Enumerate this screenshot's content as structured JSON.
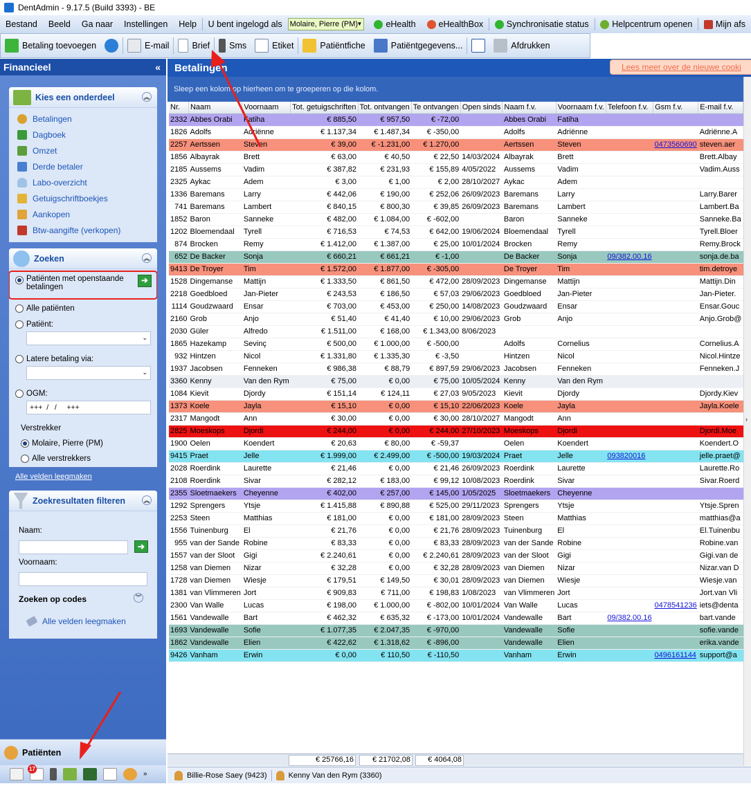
{
  "app": {
    "title": "DentAdmin - 9.17.5     (Build 3393) - BE"
  },
  "menu": {
    "items": [
      "Bestand",
      "Beeld",
      "Ga naar",
      "Instellingen",
      "Help"
    ],
    "logged_in_label": "U bent ingelogd als",
    "user_value": "Molaire, Pierre (PM)",
    "ehealth": "eHealth",
    "ehealthbox": "eHealthBox",
    "sync": "Synchronisatie status",
    "help": "Helpcentrum openen",
    "mine": "Mijn afs"
  },
  "toolbar": {
    "add_payment": "Betaling toevoegen",
    "email": "E-mail",
    "letter": "Brief",
    "sms": "Sms",
    "label": "Etiket",
    "patient_card": "Patiëntfiche",
    "patient_data": "Patiëntgegevens...",
    "print": "Afdrukken"
  },
  "sidebar": {
    "title": "Financieel",
    "collapse": "«",
    "choose": {
      "title": "Kies een onderdeel",
      "items": [
        "Betalingen",
        "Dagboek",
        "Omzet",
        "Derde betaler",
        "Labo-overzicht",
        "Getuigschriftboekjes",
        "Aankopen",
        "Btw-aangifte (verkopen)"
      ]
    },
    "search": {
      "title": "Zoeken",
      "opt_open": "Patiënten met openstaande betalingen",
      "opt_all": "Alle patiënten",
      "opt_patient": "Patiënt:",
      "opt_later": "Latere betaling via:",
      "opt_ogm": "OGM:",
      "ogm_value": "+++  /   /     +++",
      "provider_label": "Verstrekker",
      "provider_self": "Molaire, Pierre (PM)",
      "provider_all": "Alle verstrekkers",
      "clear_fields": "Alle velden leegmaken"
    },
    "filter": {
      "title": "Zoekresultaten filteren",
      "name_label": "Naam:",
      "firstname_label": "Voornaam:",
      "codes_label": "Zoeken op codes",
      "clear": "Alle velden leegmaken"
    },
    "patients_nav": "Patiënten",
    "badge_count": "17"
  },
  "main": {
    "title": "Betalingen",
    "learn_more": "Lees meer over de nieuwe cooki",
    "group_hint": "Sleep een kolom op hierheen om te groeperen op die kolom.",
    "columns": [
      "Nr.",
      "Naam",
      "Voornaam",
      "Tot. getuigschriften",
      "Tot. ontvangen",
      "Te ontvangen",
      "Open sinds",
      "Naam f.v.",
      "Voornaam f.v.",
      "Telefoon f.v.",
      "Gsm f.v.",
      "E-mail f.v."
    ],
    "rows": [
      [
        "2332",
        "Abbes Orabi",
        "Fatiha",
        "€ 885,50",
        "€ 957,50",
        "€ -72,00",
        "",
        "Abbes Orabi",
        "Fatiha",
        "",
        "",
        ""
      ],
      [
        "1826",
        "Adolfs",
        "Adriënne",
        "€ 1.137,34",
        "€ 1.487,34",
        "€ -350,00",
        "",
        "Adolfs",
        "Adriënne",
        "",
        "",
        "Adriënne.A"
      ],
      [
        "2257",
        "Aertssen",
        "Steven",
        "€ 39,00",
        "€ -1.231,00",
        "€ 1.270,00",
        "",
        "Aertssen",
        "Steven",
        "",
        "0473560690",
        "steven.aer"
      ],
      [
        "1856",
        "Albayrak",
        "Brett",
        "€ 63,00",
        "€ 40,50",
        "€ 22,50",
        "14/03/2024",
        "Albayrak",
        "Brett",
        "",
        "",
        "Brett.Albay"
      ],
      [
        "2185",
        "Aussems",
        "Vadim",
        "€ 387,82",
        "€ 231,93",
        "€ 155,89",
        "4/05/2022",
        "Aussems",
        "Vadim",
        "",
        "",
        "Vadim.Auss"
      ],
      [
        "2325",
        "Aykac",
        "Adem",
        "€ 3,00",
        "€ 1,00",
        "€ 2,00",
        "28/10/2027",
        "Aykac",
        "Adem",
        "",
        "",
        ""
      ],
      [
        "1336",
        "Baremans",
        "Larry",
        "€ 442,06",
        "€ 190,00",
        "€ 252,06",
        "26/09/2023",
        "Baremans",
        "Larry",
        "",
        "",
        "Larry.Barer"
      ],
      [
        "741",
        "Baremans",
        "Lambert",
        "€ 840,15",
        "€ 800,30",
        "€ 39,85",
        "26/09/2023",
        "Baremans",
        "Lambert",
        "",
        "",
        "Lambert.Ba"
      ],
      [
        "1852",
        "Baron",
        "Sanneke",
        "€ 482,00",
        "€ 1.084,00",
        "€ -602,00",
        "",
        "Baron",
        "Sanneke",
        "",
        "",
        "Sanneke.Ba"
      ],
      [
        "1202",
        "Bloemendaal",
        "Tyrell",
        "€ 716,53",
        "€ 74,53",
        "€ 642,00",
        "19/06/2024",
        "Bloemendaal",
        "Tyrell",
        "",
        "",
        "Tyrell.Bloer"
      ],
      [
        "874",
        "Brocken",
        "Remy",
        "€ 1.412,00",
        "€ 1.387,00",
        "€ 25,00",
        "10/01/2024",
        "Brocken",
        "Remy",
        "",
        "",
        "Remy.Brock"
      ],
      [
        "652",
        "De Backer",
        "Sonja",
        "€ 660,21",
        "€ 661,21",
        "€ -1,00",
        "",
        "De Backer",
        "Sonja",
        "09/382.00.16",
        "",
        "sonja.de.ba"
      ],
      [
        "9413",
        "De Troyer",
        "Tim",
        "€ 1.572,00",
        "€ 1.877,00",
        "€ -305,00",
        "",
        "De Troyer",
        "Tim",
        "",
        "",
        "tim.detroye"
      ],
      [
        "1528",
        "Dingemanse",
        "Mattijn",
        "€ 1.333,50",
        "€ 861,50",
        "€ 472,00",
        "28/09/2023",
        "Dingemanse",
        "Mattijn",
        "",
        "",
        "Mattijn.Din"
      ],
      [
        "2218",
        "Goedbloed",
        "Jan-Pieter",
        "€ 243,53",
        "€ 186,50",
        "€ 57,03",
        "29/06/2023",
        "Goedbloed",
        "Jan-Pieter",
        "",
        "",
        "Jan-Pieter."
      ],
      [
        "1114",
        "Goudzwaard",
        "Ensar",
        "€ 703,00",
        "€ 453,00",
        "€ 250,00",
        "14/08/2023",
        "Goudzwaard",
        "Ensar",
        "",
        "",
        "Ensar.Gouc"
      ],
      [
        "2160",
        "Grob",
        "Anjo",
        "€ 51,40",
        "€ 41,40",
        "€ 10,00",
        "29/06/2023",
        "Grob",
        "Anjo",
        "",
        "",
        "Anjo.Grob@"
      ],
      [
        "2030",
        "Güler",
        "Alfredo",
        "€ 1.511,00",
        "€ 168,00",
        "€ 1.343,00",
        "8/06/2023",
        "",
        "",
        "",
        "",
        ""
      ],
      [
        "1865",
        "Hazekamp",
        "Sevinç",
        "€ 500,00",
        "€ 1.000,00",
        "€ -500,00",
        "",
        "Adolfs",
        "Cornelius",
        "",
        "",
        "Cornelius.A"
      ],
      [
        "932",
        "Hintzen",
        "Nicol",
        "€ 1.331,80",
        "€ 1.335,30",
        "€ -3,50",
        "",
        "Hintzen",
        "Nicol",
        "",
        "",
        "Nicol.Hintze"
      ],
      [
        "1937",
        "Jacobsen",
        "Fenneken",
        "€ 986,38",
        "€ 88,79",
        "€ 897,59",
        "29/06/2023",
        "Jacobsen",
        "Fenneken",
        "",
        "",
        "Fenneken.J"
      ],
      [
        "3360",
        "Kenny",
        "Van den Rym",
        "€ 75,00",
        "€ 0,00",
        "€ 75,00",
        "10/05/2024",
        "Kenny",
        "Van den Rym",
        "",
        "",
        ""
      ],
      [
        "1084",
        "Kievit",
        "Djordy",
        "€ 151,14",
        "€ 124,11",
        "€ 27,03",
        "9/05/2023",
        "Kievit",
        "Djordy",
        "",
        "",
        "Djordy.Kiev"
      ],
      [
        "1373",
        "Koele",
        "Jayla",
        "€ 15,10",
        "€ 0,00",
        "€ 15,10",
        "22/06/2023",
        "Koele",
        "Jayla",
        "",
        "",
        "Jayla.Koele"
      ],
      [
        "2317",
        "Mangodt",
        "Ann",
        "€ 30,00",
        "€ 0,00",
        "€ 30,00",
        "28/10/2027",
        "Mangodt",
        "Ann",
        "",
        "",
        ""
      ],
      [
        "2825",
        "Moeskops",
        "Djordi",
        "€ 244,00",
        "€ 0,00",
        "€ 244,00",
        "27/10/2023",
        "Moeskops",
        "Djordi",
        "",
        "",
        "Djordi.Moe"
      ],
      [
        "1900",
        "Oelen",
        "Koendert",
        "€ 20,63",
        "€ 80,00",
        "€ -59,37",
        "",
        "Oelen",
        "Koendert",
        "",
        "",
        "Koendert.O"
      ],
      [
        "9415",
        "Praet",
        "Jelle",
        "€ 1.999,00",
        "€ 2.499,00",
        "€ -500,00",
        "19/03/2024",
        "Praet",
        "Jelle",
        "093820016",
        "",
        "jelle.praet@"
      ],
      [
        "2028",
        "Roerdink",
        "Laurette",
        "€ 21,46",
        "€ 0,00",
        "€ 21,46",
        "26/09/2023",
        "Roerdink",
        "Laurette",
        "",
        "",
        "Laurette.Ro"
      ],
      [
        "2108",
        "Roerdink",
        "Sivar",
        "€ 282,12",
        "€ 183,00",
        "€ 99,12",
        "10/08/2023",
        "Roerdink",
        "Sivar",
        "",
        "",
        "Sivar.Roerd"
      ],
      [
        "2355",
        "Sloetmaekers",
        "Cheyenne",
        "€ 402,00",
        "€ 257,00",
        "€ 145,00",
        "1/05/2025",
        "Sloetmaekers",
        "Cheyenne",
        "",
        "",
        ""
      ],
      [
        "1292",
        "Sprengers",
        "Ytsje",
        "€ 1.415,88",
        "€ 890,88",
        "€ 525,00",
        "29/11/2023",
        "Sprengers",
        "Ytsje",
        "",
        "",
        "Ytsje.Spren"
      ],
      [
        "2253",
        "Steen",
        "Matthias",
        "€ 181,00",
        "€ 0,00",
        "€ 181,00",
        "28/09/2023",
        "Steen",
        "Matthias",
        "",
        "",
        "matthias@a"
      ],
      [
        "1556",
        "Tuinenburg",
        "El",
        "€ 21,76",
        "€ 0,00",
        "€ 21,76",
        "28/09/2023",
        "Tuinenburg",
        "El",
        "",
        "",
        "El.Tuinenbu"
      ],
      [
        "955",
        "van der Sande",
        "Robine",
        "€ 83,33",
        "€ 0,00",
        "€ 83,33",
        "28/09/2023",
        "van der Sande",
        "Robine",
        "",
        "",
        "Robine.van"
      ],
      [
        "1557",
        "van der Sloot",
        "Gigi",
        "€ 2.240,61",
        "€ 0,00",
        "€ 2.240,61",
        "28/09/2023",
        "van der Sloot",
        "Gigi",
        "",
        "",
        "Gigi.van de"
      ],
      [
        "1258",
        "van Diemen",
        "Nizar",
        "€ 32,28",
        "€ 0,00",
        "€ 32,28",
        "28/09/2023",
        "van Diemen",
        "Nizar",
        "",
        "",
        "Nizar.van D"
      ],
      [
        "1728",
        "van Diemen",
        "Wiesje",
        "€ 179,51",
        "€ 149,50",
        "€ 30,01",
        "28/09/2023",
        "van Diemen",
        "Wiesje",
        "",
        "",
        "Wiesje.van"
      ],
      [
        "1381",
        "van Vlimmeren",
        "Jort",
        "€ 909,83",
        "€ 711,00",
        "€ 198,83",
        "1/08/2023",
        "van Vlimmeren",
        "Jort",
        "",
        "",
        "Jort.van Vli"
      ],
      [
        "2300",
        "Van Walle",
        "Lucas",
        "€ 198,00",
        "€ 1.000,00",
        "€ -802,00",
        "10/01/2024",
        "Van Walle",
        "Lucas",
        "",
        "0478541236",
        "iets@denta"
      ],
      [
        "1561",
        "Vandewalle",
        "Bart",
        "€ 462,32",
        "€ 635,32",
        "€ -173,00",
        "10/01/2024",
        "Vandewalle",
        "Bart",
        "09/382.00.16",
        "",
        "bart.vande"
      ],
      [
        "1693",
        "Vandewalle",
        "Sofie",
        "€ 1.077,35",
        "€ 2.047,35",
        "€ -970,00",
        "",
        "Vandewalle",
        "Sofie",
        "",
        "",
        "sofie.vande"
      ],
      [
        "1862",
        "Vandewalle",
        "Elien",
        "€ 422,62",
        "€ 1.318,62",
        "€ -896,00",
        "",
        "Vandewalle",
        "Elien",
        "",
        "",
        "erika.vande"
      ],
      [
        "9426",
        "Vanham",
        "Erwin",
        "€ 0,00",
        "€ 110,50",
        "€ -110,50",
        "",
        "Vanham",
        "Erwin",
        "",
        "0496161144",
        "support@a"
      ]
    ],
    "row_colors": [
      "purple",
      "",
      "salmon",
      "",
      "",
      "",
      "",
      "",
      "",
      "",
      "",
      "teal",
      "salmon",
      "",
      "",
      "",
      "",
      "",
      "",
      "",
      "",
      "gray",
      "",
      "salmon",
      "",
      "red",
      "",
      "cyan",
      "",
      "",
      "purple",
      "",
      "",
      "",
      "",
      "",
      "",
      "",
      "",
      "",
      "",
      "teal",
      "teal",
      "cyan"
    ],
    "totals": [
      "€ 25766,16",
      "€ 21702,08",
      "€ 4064,08"
    ]
  },
  "status": {
    "user1": "Billie-Rose Saey (9423)",
    "user2": "Kenny Van den Rym (3360)"
  },
  "colors": {
    "accent": "#1e58b8",
    "highlight_box": "#e8201c",
    "arrow": "#e8201c"
  }
}
